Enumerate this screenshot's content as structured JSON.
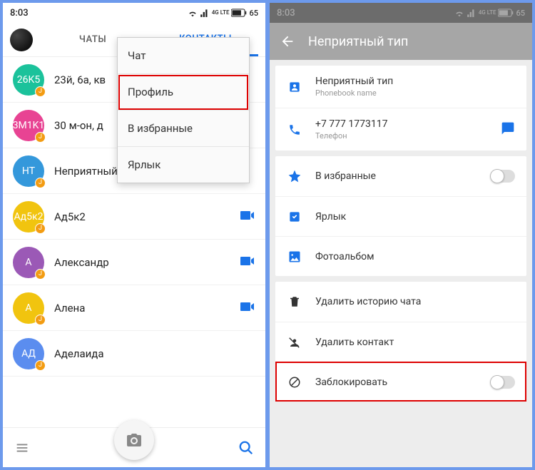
{
  "status": {
    "time": "8:03",
    "battery": "65",
    "net": "4G LTE"
  },
  "left": {
    "tabs": {
      "chats": "ЧАТЫ",
      "contacts": "КОНТАКТЫ"
    },
    "contacts": [
      {
        "avatar": "26K5",
        "color": "#1bc29b",
        "name": "23й, 6а, кв",
        "video": false
      },
      {
        "avatar": "3M1K1",
        "color": "#e84393",
        "name": "30 м-он, д",
        "video": false
      },
      {
        "avatar": "НТ",
        "color": "#3498db",
        "name": "Неприятный тип",
        "video": false
      },
      {
        "avatar": "Ад5к2",
        "color": "#f1c40f",
        "name": "Ад5к2",
        "video": true
      },
      {
        "avatar": "А",
        "color": "#9b59b6",
        "name": "Александр",
        "video": true
      },
      {
        "avatar": "А",
        "color": "#f1c40f",
        "name": "Алена",
        "video": true
      },
      {
        "avatar": "АД",
        "color": "#5b8def",
        "name": "Аделаида",
        "video": false
      }
    ],
    "menu": {
      "chat": "Чат",
      "profile": "Профиль",
      "favorite": "В избранные",
      "shortcut": "Ярлык"
    }
  },
  "right": {
    "title": "Неприятный тип",
    "name_row": {
      "name": "Неприятный тип",
      "sub": "Phonebook name"
    },
    "phone_row": {
      "number": "+7 777 1773117",
      "sub": "Телефон"
    },
    "fav": "В избранные",
    "shortcut": "Ярлык",
    "album": "Фотоальбом",
    "del_history": "Удалить историю чата",
    "del_contact": "Удалить контакт",
    "block": "Заблокировать"
  }
}
